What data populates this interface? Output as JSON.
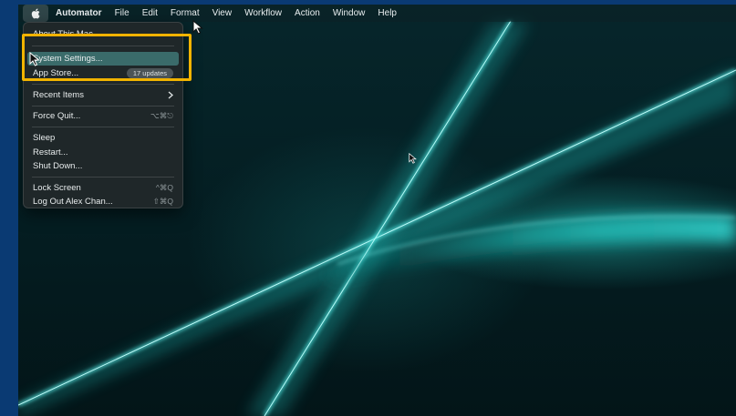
{
  "menubar": {
    "app_name": "Automator",
    "items": [
      "File",
      "Edit",
      "Format",
      "View",
      "Workflow",
      "Action",
      "Window",
      "Help"
    ]
  },
  "apple_menu": {
    "about": "About This Mac",
    "system_settings": "System Settings...",
    "app_store": "App Store...",
    "app_store_badge": "17 updates",
    "recent_items": "Recent Items",
    "force_quit": "Force Quit...",
    "force_quit_shortcut": "⌥⌘⎋",
    "sleep": "Sleep",
    "restart": "Restart...",
    "shut_down": "Shut Down...",
    "lock_screen": "Lock Screen",
    "lock_screen_shortcut": "^⌘Q",
    "log_out": "Log Out Alex Chan...",
    "log_out_shortcut": "⇧⌘Q"
  },
  "colors": {
    "accent_highlight": "#3a6b6a",
    "callout_border": "#f1b300",
    "wallpaper_glow": "#2fe3e0"
  },
  "icons": {
    "apple": "apple-logo-icon",
    "submenu": "chevron-right-icon",
    "pointer": "mouse-pointer-icon"
  }
}
